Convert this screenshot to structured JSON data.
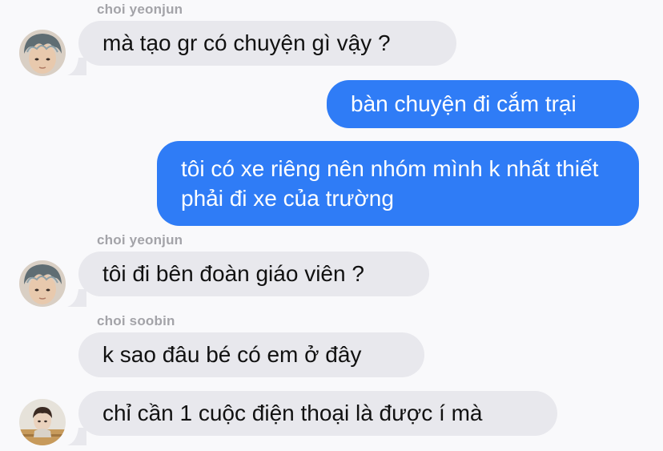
{
  "messages": [
    {
      "sender": "choi yeonjun",
      "text": "mà tạo gr có chuyện gì vậy ?"
    },
    {
      "text": "bàn chuyện đi cắm trại"
    },
    {
      "text": "tôi có xe riêng nên nhóm mình k nhất thiết phải đi xe của trường"
    },
    {
      "sender": "choi yeonjun",
      "text": "tôi đi bên đoàn giáo viên ?"
    },
    {
      "sender": "choi soobin",
      "text": "k sao đâu bé có em ở đây"
    },
    {
      "text": "chỉ cần 1 cuộc điện thoại là được í mà"
    }
  ],
  "colors": {
    "background": "#f9f9fb",
    "incoming_bubble": "#e8e8ed",
    "outgoing_bubble": "#2f7cf6",
    "sender_name": "#a3a3a8"
  }
}
